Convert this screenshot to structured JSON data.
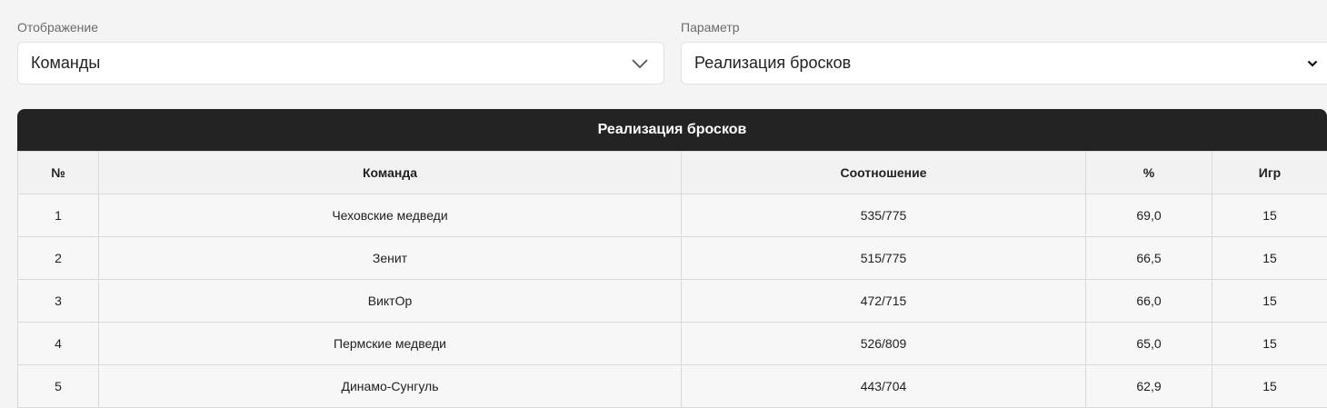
{
  "filters": {
    "display": {
      "label": "Отображение",
      "value": "Команды"
    },
    "parameter": {
      "label": "Параметр",
      "value": "Реализация бросков"
    }
  },
  "table": {
    "title": "Реализация бросков",
    "columns": [
      "№",
      "Команда",
      "Соотношение",
      "%",
      "Игр"
    ],
    "rows": [
      [
        "1",
        "Чеховские медведи",
        "535/775",
        "69,0",
        "15"
      ],
      [
        "2",
        "Зенит",
        "515/775",
        "66,5",
        "15"
      ],
      [
        "3",
        "ВиктОр",
        "472/715",
        "66,0",
        "15"
      ],
      [
        "4",
        "Пермские медведи",
        "526/809",
        "65,0",
        "15"
      ],
      [
        "5",
        "Динамо-Сунгуль",
        "443/704",
        "62,9",
        "15"
      ]
    ]
  },
  "icons": {
    "dropdown": "chevron-down-icon"
  }
}
